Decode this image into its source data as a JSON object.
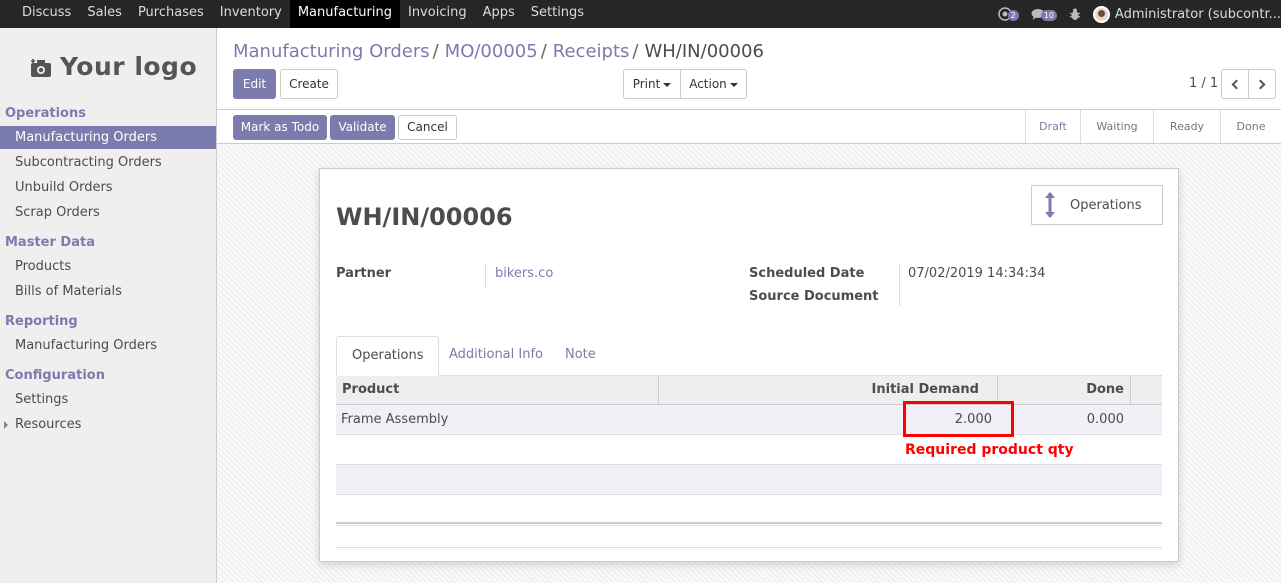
{
  "topmenu": {
    "items": [
      "Discuss",
      "Sales",
      "Purchases",
      "Inventory",
      "Manufacturing",
      "Invoicing",
      "Apps",
      "Settings"
    ],
    "active": "Manufacturing"
  },
  "systray": {
    "messages_count": "2",
    "activity_count": "10",
    "user": "Administrator (subcontr..."
  },
  "logo": {
    "text": "Your logo"
  },
  "sidebar": {
    "sections": [
      {
        "title": "Operations",
        "items": [
          "Manufacturing Orders",
          "Subcontracting Orders",
          "Unbuild Orders",
          "Scrap Orders"
        ]
      },
      {
        "title": "Master Data",
        "items": [
          "Products",
          "Bills of Materials"
        ]
      },
      {
        "title": "Reporting",
        "items": [
          "Manufacturing Orders"
        ]
      },
      {
        "title": "Configuration",
        "items": [
          "Settings",
          "Resources"
        ]
      }
    ],
    "active_item": "Manufacturing Orders"
  },
  "breadcrumb": {
    "items": [
      "Manufacturing Orders",
      "MO/00005",
      "Receipts"
    ],
    "separator": "/",
    "current": "WH/IN/00006"
  },
  "buttons": {
    "edit": "Edit",
    "create": "Create",
    "print": "Print",
    "action": "Action"
  },
  "pager": {
    "value": "1 / 1"
  },
  "statusbar": {
    "mark_as_todo": "Mark as Todo",
    "validate": "Validate",
    "cancel": "Cancel",
    "stages": [
      "Draft",
      "Waiting",
      "Ready",
      "Done"
    ],
    "current_stage": "Draft"
  },
  "record": {
    "smart_button": "Operations",
    "title": "WH/IN/00006",
    "partner_label": "Partner",
    "partner_value": "bikers.co",
    "scheduled_label": "Scheduled Date",
    "scheduled_value": "07/02/2019 14:34:34",
    "source_label": "Source Document"
  },
  "tabs": [
    "Operations",
    "Additional Info",
    "Note"
  ],
  "table": {
    "headers": {
      "product": "Product",
      "initial_demand": "Initial Demand",
      "done": "Done"
    },
    "rows": [
      {
        "product": "Frame Assembly",
        "initial_demand": "2.000",
        "done": "0.000"
      }
    ]
  },
  "annotation": {
    "text": "Required product qty",
    "color": "#ff0000"
  },
  "colors": {
    "brand": "#7c7bad",
    "topbar": "#262626",
    "sidebar": "#f0eeee"
  }
}
